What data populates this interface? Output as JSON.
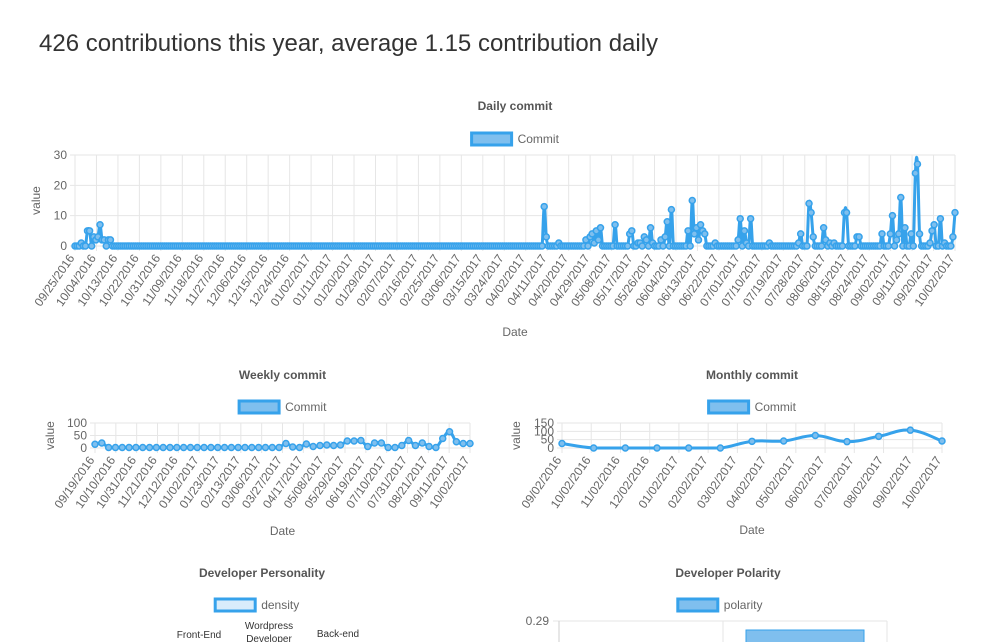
{
  "headline": "426 contributions this year, average 1.15 contribution daily",
  "colors": {
    "series_fill": "#7fbfee",
    "series_stroke": "#36a2eb",
    "density_fill": "#d8ecfb",
    "grid": "#e6e6e6",
    "text": "#666666",
    "title": "#555555"
  },
  "chart_data": [
    {
      "id": "daily",
      "type": "line",
      "title": "Daily commit",
      "legend": "Commit",
      "legend_position": "top",
      "xlabel": "Date",
      "ylabel": "value",
      "ylim": [
        0,
        30
      ],
      "yticks": [
        0,
        10,
        20,
        30
      ],
      "grid": true,
      "x_tick_labels": [
        "09/25/2016",
        "10/04/2016",
        "10/13/2016",
        "10/22/2016",
        "10/31/2016",
        "11/09/2016",
        "11/18/2016",
        "11/27/2016",
        "12/06/2016",
        "12/15/2016",
        "12/24/2016",
        "01/02/2017",
        "01/11/2017",
        "01/20/2017",
        "01/29/2017",
        "02/07/2017",
        "02/16/2017",
        "02/25/2017",
        "03/06/2017",
        "03/15/2017",
        "03/24/2017",
        "04/02/2017",
        "04/11/2017",
        "04/20/2017",
        "04/29/2017",
        "05/08/2017",
        "05/17/2017",
        "05/26/2017",
        "06/04/2017",
        "06/13/2017",
        "06/22/2017",
        "07/01/2017",
        "07/10/2017",
        "07/19/2017",
        "07/28/2017",
        "08/06/2017",
        "08/15/2017",
        "08/24/2017",
        "09/02/2017",
        "09/11/2017",
        "09/20/2017",
        "10/02/2017"
      ],
      "values": [
        0,
        0,
        0,
        1,
        0,
        0,
        5,
        5,
        0,
        3,
        2,
        3,
        7,
        2,
        2,
        0,
        2,
        2,
        0,
        0,
        0,
        0,
        0,
        0,
        0,
        0,
        0,
        0,
        0,
        0,
        0,
        0,
        0,
        0,
        0,
        0,
        0,
        0,
        0,
        0,
        0,
        0,
        0,
        0,
        0,
        0,
        0,
        0,
        0,
        0,
        0,
        0,
        0,
        0,
        0,
        0,
        0,
        0,
        0,
        0,
        0,
        0,
        0,
        0,
        0,
        0,
        0,
        0,
        0,
        0,
        0,
        0,
        0,
        0,
        0,
        0,
        0,
        0,
        0,
        0,
        0,
        0,
        0,
        0,
        0,
        0,
        0,
        0,
        0,
        0,
        0,
        0,
        0,
        0,
        0,
        0,
        0,
        0,
        0,
        0,
        0,
        0,
        0,
        0,
        0,
        0,
        0,
        0,
        0,
        0,
        0,
        0,
        0,
        0,
        0,
        0,
        0,
        0,
        0,
        0,
        0,
        0,
        0,
        0,
        0,
        0,
        0,
        0,
        0,
        0,
        0,
        0,
        0,
        0,
        0,
        0,
        0,
        0,
        0,
        0,
        0,
        0,
        0,
        0,
        0,
        0,
        0,
        0,
        0,
        0,
        0,
        0,
        0,
        0,
        0,
        0,
        0,
        0,
        0,
        0,
        0,
        0,
        0,
        0,
        0,
        0,
        0,
        0,
        0,
        0,
        0,
        0,
        0,
        0,
        0,
        0,
        0,
        0,
        0,
        0,
        0,
        0,
        0,
        0,
        0,
        0,
        0,
        0,
        0,
        0,
        0,
        0,
        0,
        0,
        0,
        0,
        0,
        0,
        0,
        0,
        0,
        0,
        0,
        0,
        0,
        0,
        0,
        0,
        0,
        0,
        0,
        0,
        0,
        0,
        0,
        0,
        0,
        0,
        0,
        0,
        0,
        0,
        0,
        0,
        0,
        13,
        3,
        0,
        0,
        0,
        0,
        0,
        1,
        0,
        0,
        0,
        0,
        0,
        0,
        0,
        0,
        0,
        0,
        0,
        0,
        2,
        0,
        3,
        4,
        1,
        5,
        2,
        6,
        0,
        0,
        0,
        0,
        0,
        0,
        7,
        0,
        0,
        0,
        0,
        0,
        0,
        4,
        5,
        0,
        0,
        1,
        1,
        0,
        3,
        2,
        0,
        6,
        1,
        0,
        0,
        0,
        2,
        0,
        3,
        8,
        0,
        12,
        0,
        0,
        0,
        0,
        0,
        0,
        0,
        5,
        0,
        15,
        4,
        6,
        2,
        7,
        5,
        4,
        0,
        0,
        0,
        0,
        1,
        0,
        0,
        0,
        0,
        0,
        0,
        0,
        0,
        0,
        0,
        2,
        9,
        0,
        5,
        1,
        0,
        9,
        0,
        0,
        0,
        0,
        0,
        0,
        0,
        0,
        1,
        0,
        0,
        0,
        0,
        0,
        0,
        0,
        0,
        0,
        0,
        0,
        0,
        0,
        1,
        4,
        0,
        0,
        0,
        14,
        11,
        3,
        0,
        0,
        0,
        0,
        6,
        2,
        0,
        1,
        0,
        1,
        0,
        0,
        0,
        0,
        11,
        11,
        0,
        0,
        0,
        0,
        3,
        3,
        0,
        0,
        0,
        0,
        0,
        0,
        0,
        0,
        0,
        0,
        4,
        0,
        0,
        0,
        4,
        10,
        0,
        2,
        4,
        16,
        0,
        6,
        0,
        0,
        4,
        0,
        24,
        27,
        4,
        0,
        0,
        0,
        0,
        1,
        5,
        7,
        0,
        0,
        9,
        0,
        1,
        0,
        0,
        0,
        3,
        11
      ]
    },
    {
      "id": "weekly",
      "type": "line",
      "title": "Weekly commit",
      "legend": "Commit",
      "legend_position": "top",
      "xlabel": "Date",
      "ylabel": "value",
      "ylim": [
        0,
        100
      ],
      "yticks": [
        0,
        50,
        100
      ],
      "grid": true,
      "x_tick_labels": [
        "09/19/2016",
        "10/10/2016",
        "10/31/2016",
        "11/21/2016",
        "12/12/2016",
        "01/02/2017",
        "01/23/2017",
        "02/13/2017",
        "03/06/2017",
        "03/27/2017",
        "04/17/2017",
        "05/08/2017",
        "05/29/2017",
        "06/19/2017",
        "07/10/2017",
        "07/31/2017",
        "08/21/2017",
        "09/11/2017",
        "10/02/2017"
      ],
      "values": [
        15,
        20,
        2,
        2,
        2,
        2,
        2,
        2,
        2,
        2,
        2,
        2,
        2,
        2,
        2,
        2,
        2,
        2,
        2,
        2,
        2,
        2,
        2,
        2,
        2,
        2,
        2,
        2,
        18,
        4,
        2,
        16,
        6,
        10,
        12,
        10,
        12,
        28,
        28,
        30,
        6,
        20,
        20,
        2,
        2,
        10,
        30,
        10,
        20,
        6,
        2,
        38,
        65,
        25,
        18,
        18
      ]
    },
    {
      "id": "monthly",
      "type": "line",
      "title": "Monthly commit",
      "legend": "Commit",
      "legend_position": "top",
      "xlabel": "Date",
      "ylabel": "value",
      "ylim": [
        0,
        150
      ],
      "yticks": [
        0,
        50,
        100,
        150
      ],
      "grid": true,
      "x_tick_labels": [
        "09/02/2016",
        "10/02/2016",
        "11/02/2016",
        "12/02/2016",
        "01/02/2017",
        "02/02/2017",
        "03/02/2017",
        "04/02/2017",
        "05/02/2017",
        "06/02/2017",
        "07/02/2017",
        "08/02/2017",
        "09/02/2017",
        "10/02/2017"
      ],
      "values": [
        27,
        0,
        0,
        0,
        0,
        0,
        40,
        42,
        75,
        38,
        70,
        107,
        42
      ]
    },
    {
      "id": "personality",
      "type": "radar",
      "title": "Developer Personality",
      "legend": "density",
      "legend_position": "top",
      "axis_labels": [
        "Front-End",
        "Wordpress Developer",
        "Back-end"
      ]
    },
    {
      "id": "polarity",
      "type": "bar",
      "title": "Developer Polarity",
      "legend": "polarity",
      "legend_position": "top",
      "yticks": [
        "0.29"
      ],
      "grid": true
    }
  ]
}
